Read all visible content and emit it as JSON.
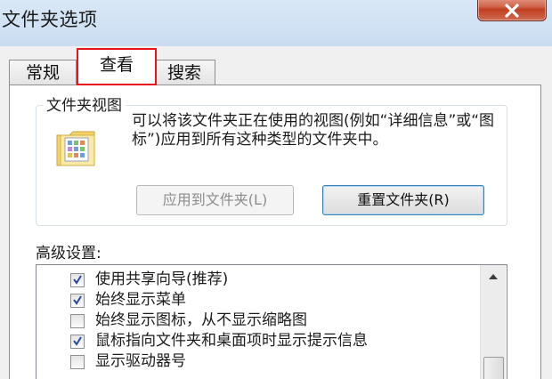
{
  "window": {
    "title": "文件夹选项"
  },
  "tabs": [
    {
      "label": "常规",
      "selected": false
    },
    {
      "label": "查看",
      "selected": true,
      "highlight_color": "#e8141a"
    },
    {
      "label": "搜索",
      "selected": false
    }
  ],
  "folder_views": {
    "group_label": "文件夹视图",
    "description": "可以将该文件夹正在使用的视图(例如“详细信息”或“图标”)应用到所有这种类型的文件夹中。",
    "apply_button": "应用到文件夹(L)",
    "apply_enabled": false,
    "reset_button": "重置文件夹(R)"
  },
  "advanced": {
    "label": "高级设置:",
    "items": [
      {
        "label": "使用共享向导(推荐)",
        "checked": true
      },
      {
        "label": "始终显示菜单",
        "checked": true
      },
      {
        "label": "始终显示图标，从不显示缩略图",
        "checked": false
      },
      {
        "label": "鼠标指向文件夹和桌面项时显示提示信息",
        "checked": true
      },
      {
        "label": "显示驱动器号",
        "checked": false
      }
    ]
  },
  "icons": {
    "close": "close-icon",
    "folder": "folder-view-icon",
    "scroll_up": "scroll-up-arrow-icon"
  },
  "colors": {
    "close_button": "#c13f22",
    "check": "#2a4a9e"
  }
}
